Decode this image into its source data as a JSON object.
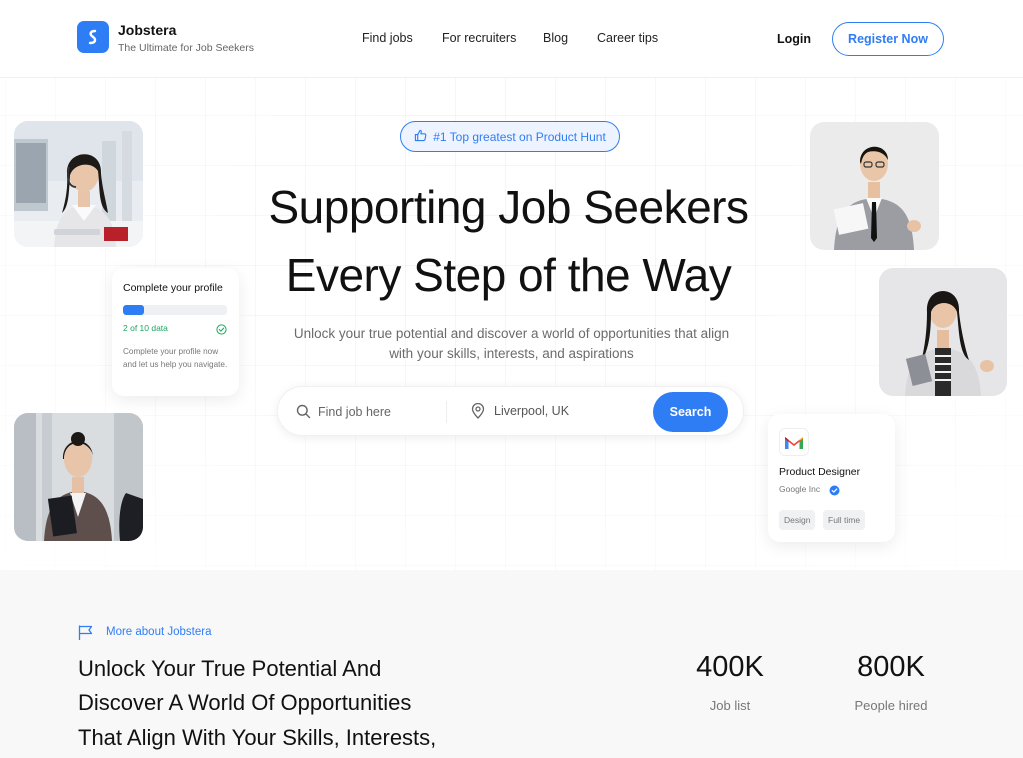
{
  "brand": {
    "name": "Jobstera",
    "tagline": "The Ultimate for Job Seekers"
  },
  "nav": {
    "links": [
      "Find jobs",
      "For recruiters",
      "Blog",
      "Career tips"
    ],
    "login": "Login",
    "register": "Register Now"
  },
  "hero": {
    "badge": "#1 Top greatest on Product Hunt",
    "title_line1": "Supporting Job Seekers",
    "title_line2": "Every Step of the Way",
    "subtitle_line1": "Unlock your true potential and discover a world of opportunities that align",
    "subtitle_line2": "with your skills, interests, and aspirations"
  },
  "search": {
    "job_placeholder": "Find job here",
    "location_value": "Liverpool, UK",
    "button": "Search"
  },
  "profile_card": {
    "title": "Complete your profile",
    "progress_fraction": 0.2,
    "count": "2 of 10 data",
    "description": "Complete your profile now and let us help you navigate."
  },
  "job_card": {
    "title": "Product Designer",
    "company": "Google Inc",
    "tags": [
      "Design",
      "Full time"
    ]
  },
  "about": {
    "label": "More about Jobstera",
    "heading_lines": [
      "Unlock Your True Potential And",
      "Discover A World Of Opportunities",
      "That Align With Your Skills, Interests,"
    ]
  },
  "stats": [
    {
      "value": "400K",
      "label": "Job list"
    },
    {
      "value": "800K",
      "label": "People hired"
    }
  ],
  "colors": {
    "accent": "#2f7df5",
    "success": "#1aa760"
  },
  "icons": {
    "logo": "jobstera-logo-icon",
    "badge": "thumbs-up-icon",
    "search": "search-icon",
    "location": "map-pin-icon",
    "check": "check-circle-icon",
    "company": "gmail-logo-icon",
    "verified": "verified-badge-icon",
    "about": "flag-icon"
  }
}
